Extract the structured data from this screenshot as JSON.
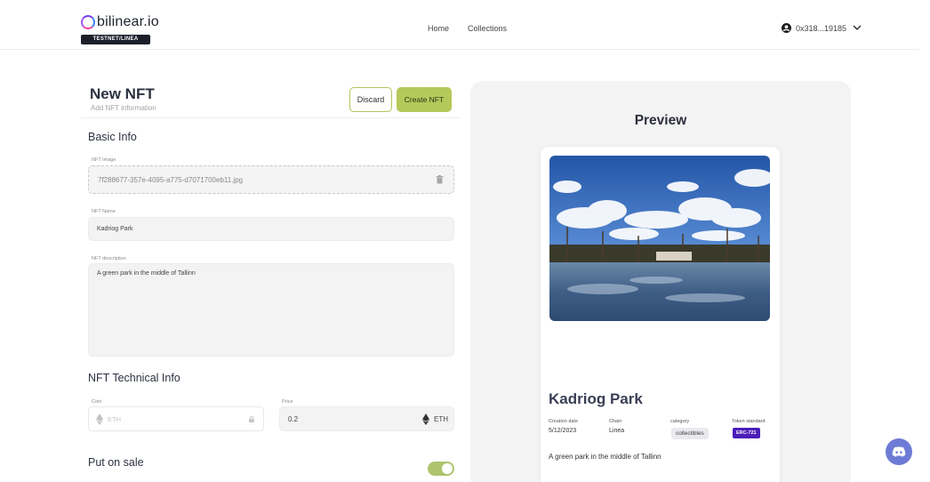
{
  "app": {
    "logo_text": "bilinear.io",
    "network_badge": "TESTNET/LINEA"
  },
  "nav": {
    "home": "Home",
    "collections": "Collections"
  },
  "account": {
    "address": "0x318...19185"
  },
  "form": {
    "title": "New NFT",
    "subtitle": "Add NFT information",
    "discard_label": "Discard",
    "create_label": "Create NFT",
    "basic_info_heading": "Basic Info",
    "image_label": "NFT Image",
    "image_filename": "7f288677-357e-4095-a775-d7071700eb11.jpg",
    "name_label": "NFT Name",
    "name_value": "Kadriog Park",
    "description_label": "NFT description",
    "description_value": "A green park in the middle of Tallinn",
    "technical_heading": "NFT Technical Info",
    "coin_label": "Coin",
    "coin_placeholder": "ETH",
    "price_label": "Price",
    "price_value": "0.2",
    "price_unit": "ETH",
    "put_on_sale_label": "Put on sale",
    "put_on_sale_enabled": true
  },
  "preview": {
    "heading": "Preview",
    "nft_name": "Kadriog Park",
    "creation_date_label": "Creation date",
    "creation_date": "5/12/2023",
    "chain_label": "Chain",
    "chain": "Linea",
    "category_label": "category",
    "category": "collectibles",
    "token_standard_label": "Token standard",
    "token_standard": "ERC-721",
    "description": "A green park in the middle of Tallinn"
  },
  "colors": {
    "accent": "#b4c95a",
    "token_badge": "#4b1db8",
    "discord": "#6d7bd6"
  },
  "icons": [
    "user-circle-icon",
    "chevron-down-icon",
    "trash-icon",
    "ethereum-icon",
    "lock-icon",
    "discord-icon"
  ]
}
